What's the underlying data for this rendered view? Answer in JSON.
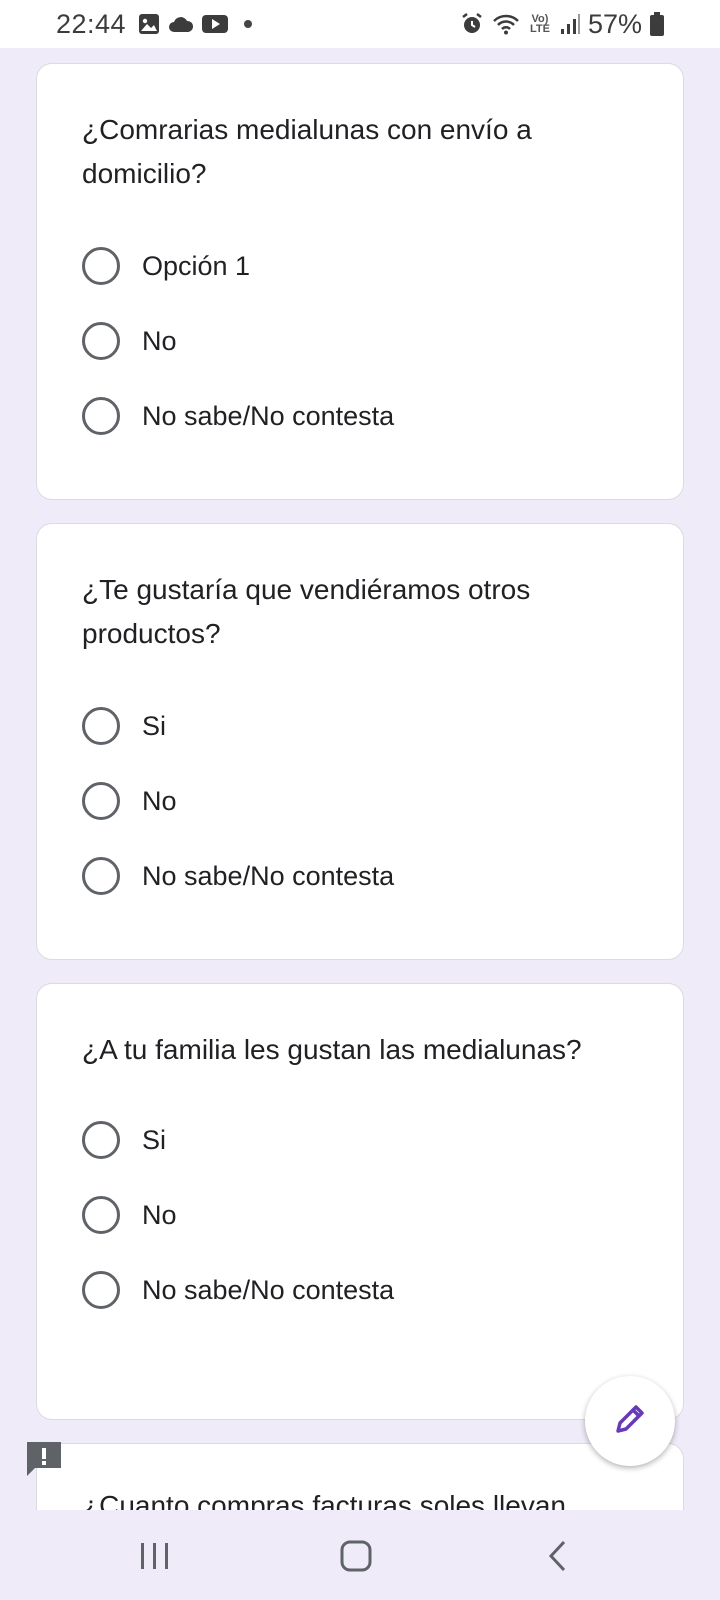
{
  "status_bar": {
    "time": "22:44",
    "battery": "57%",
    "network_label": "Vo) LTE",
    "icons_left": [
      "gallery-icon",
      "cloud-icon",
      "youtube-icon"
    ],
    "icons_right": [
      "alarm-icon",
      "wifi-icon",
      "volte-icon",
      "signal-icon",
      "battery-icon"
    ]
  },
  "questions": [
    {
      "title": "¿Comrarias medialunas con envío a domicilio?",
      "options": [
        "Opción 1",
        "No",
        "No sabe/No contesta"
      ]
    },
    {
      "title": "¿Te gustaría que vendiéramos otros productos?",
      "options": [
        "Si",
        "No",
        "No sabe/No contesta"
      ]
    },
    {
      "title": "¿A tu familia les gustan las medialunas?",
      "options": [
        "Si",
        "No",
        "No sabe/No contesta"
      ]
    },
    {
      "title": "¿Cuanto compras facturas soles llevan medialunas?"
    }
  ],
  "fab": {
    "icon": "pencil-icon"
  },
  "feedback": {
    "icon": "report-icon"
  },
  "nav": {
    "icons": [
      "recents-icon",
      "home-icon",
      "back-icon"
    ]
  },
  "colors": {
    "background": "#efebf8",
    "accent": "#673ab7",
    "radio_border": "#5f6368"
  }
}
